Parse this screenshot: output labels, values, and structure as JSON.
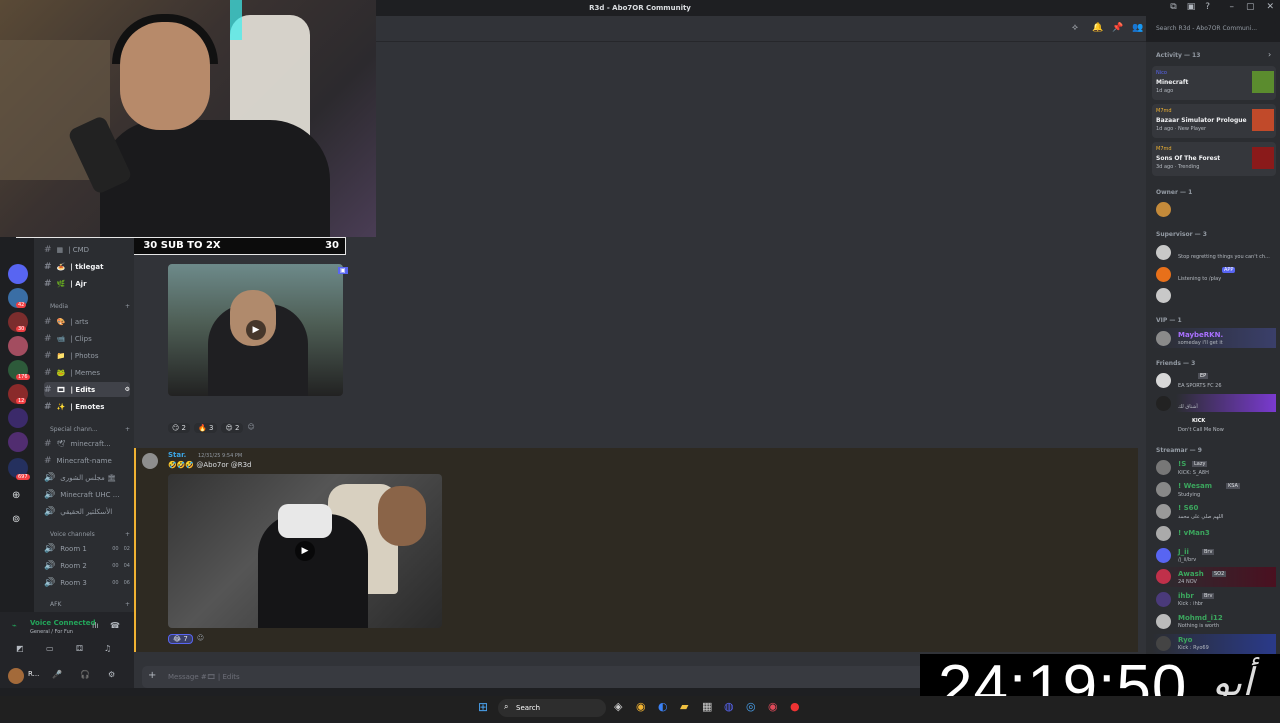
{
  "window": {
    "title": "R3d - Abo7OR Community"
  },
  "overlay": {
    "sub_goal": "30 SUB TO 2X",
    "current": "3",
    "target": "30",
    "timer": "24:19:50",
    "watermark": "أبو"
  },
  "search": {
    "placeholder": "Search R3d - Abo7OR Communi..."
  },
  "channels": {
    "top": [
      {
        "icon": "▦",
        "label": "| CMD"
      },
      {
        "icon": "🍝",
        "label": "| tklegat"
      },
      {
        "icon": "🌿",
        "label": "| Ajr"
      }
    ],
    "media_category": "Media",
    "media": [
      {
        "icon": "🎨",
        "label": "| arts"
      },
      {
        "icon": "📹",
        "label": "| Clips"
      },
      {
        "icon": "📁",
        "label": "| Photos"
      },
      {
        "icon": "🐸",
        "label": "| Memes"
      },
      {
        "icon": "🎞",
        "label": "| Edits"
      },
      {
        "icon": "✨",
        "label": "| Emotes"
      }
    ],
    "special_category": "Special chann...",
    "special": [
      {
        "icon": "🕊",
        "label": "minecraft..."
      },
      {
        "icon": "",
        "label": "Minecraft-name"
      },
      {
        "icon": "",
        "label": "مجلس الشورى 🏛"
      },
      {
        "icon": "",
        "label": "Minecraft UHC ..."
      },
      {
        "icon": "",
        "label": "الأسكلتير الحقيقي"
      }
    ],
    "voice_category": "Voice channels",
    "voice": [
      {
        "label": "Room 1",
        "count": "00",
        "limit": "02"
      },
      {
        "label": "Room 2",
        "count": "00",
        "limit": "04"
      },
      {
        "label": "Room 3",
        "count": "00",
        "limit": "06"
      }
    ],
    "afk_category": "AFK"
  },
  "voice_panel": {
    "status": "Voice Connected",
    "channel": "General / For Fun"
  },
  "user_panel": {
    "name": "R..."
  },
  "messages": {
    "first_reactions": [
      {
        "emoji": "😏",
        "count": "2"
      },
      {
        "emoji": "🔥",
        "count": "3"
      },
      {
        "emoji": "😍",
        "count": "2"
      }
    ],
    "second": {
      "author": "Star.",
      "time": "12/31/25 9:54 PM",
      "text": "🤣🤣🤣 @Abo7or @R3d",
      "reaction_emoji": "😂",
      "reaction_count": "7"
    }
  },
  "composer": {
    "placeholder": "Message #🎞 | Edits"
  },
  "members": {
    "activity_header": "Activity — 13",
    "activities": [
      {
        "user": "Nico",
        "game": "Minecraft",
        "detail": "1d ago"
      },
      {
        "user": "M7md",
        "game": "Bazaar Simulator Prologue",
        "detail": "1d ago · New Player"
      },
      {
        "user": "M7md",
        "game": "Sons Of The Forest",
        "detail": "3d ago · Trending"
      }
    ],
    "owner_header": "Owner — 1",
    "supervisor_header": "Supervisor — 3",
    "supervisors": [
      {
        "name": "",
        "status": "Stop regretting things you can't ch..."
      },
      {
        "name": "",
        "status": "Listening to /play",
        "badge": "APP"
      },
      {
        "name": "",
        "status": ""
      }
    ],
    "vip_header": "VIP — 1",
    "vip": [
      {
        "name": "MaybeRKN.",
        "status": "someday i'll get it"
      }
    ],
    "friends_header": "Friends — 3",
    "friends": [
      {
        "name": "",
        "tag": "EP",
        "status": "EA SPORTS FC 26"
      },
      {
        "name": "",
        "tag": "",
        "status": "أشتاق لك"
      },
      {
        "name": "",
        "tag": "KICK",
        "status": "Don't Call Me Now"
      }
    ],
    "streamer_header": "Streamar — 9",
    "streamers": [
      {
        "name": "!S",
        "tag": "Lazy",
        "status": "KICK: S_A8H"
      },
      {
        "name": "! Wesam",
        "tag": "KSA",
        "status": "Studying"
      },
      {
        "name": "! S60",
        "tag": "",
        "status": "اللهم صلي على محمد"
      },
      {
        "name": "! vMan3",
        "tag": "",
        "status": ""
      },
      {
        "name": "J_ii",
        "tag": "Brv",
        "status": "/j_ii/brv"
      },
      {
        "name": "Awash",
        "tag": "SO2",
        "status": "24 NOV"
      },
      {
        "name": "ihbr",
        "tag": "Brv",
        "status": "Kick : ihbr"
      },
      {
        "name": "Mohmd_i12",
        "tag": "",
        "status": "Nothing is worth"
      },
      {
        "name": "Ryo",
        "tag": "",
        "status": "Kick : Ryo69"
      }
    ]
  },
  "taskbar": {
    "search": "Search"
  },
  "colors": {
    "accent": "#5865f2",
    "streamer_green": "#3ba55d",
    "owner_gold": "#f0b232"
  }
}
